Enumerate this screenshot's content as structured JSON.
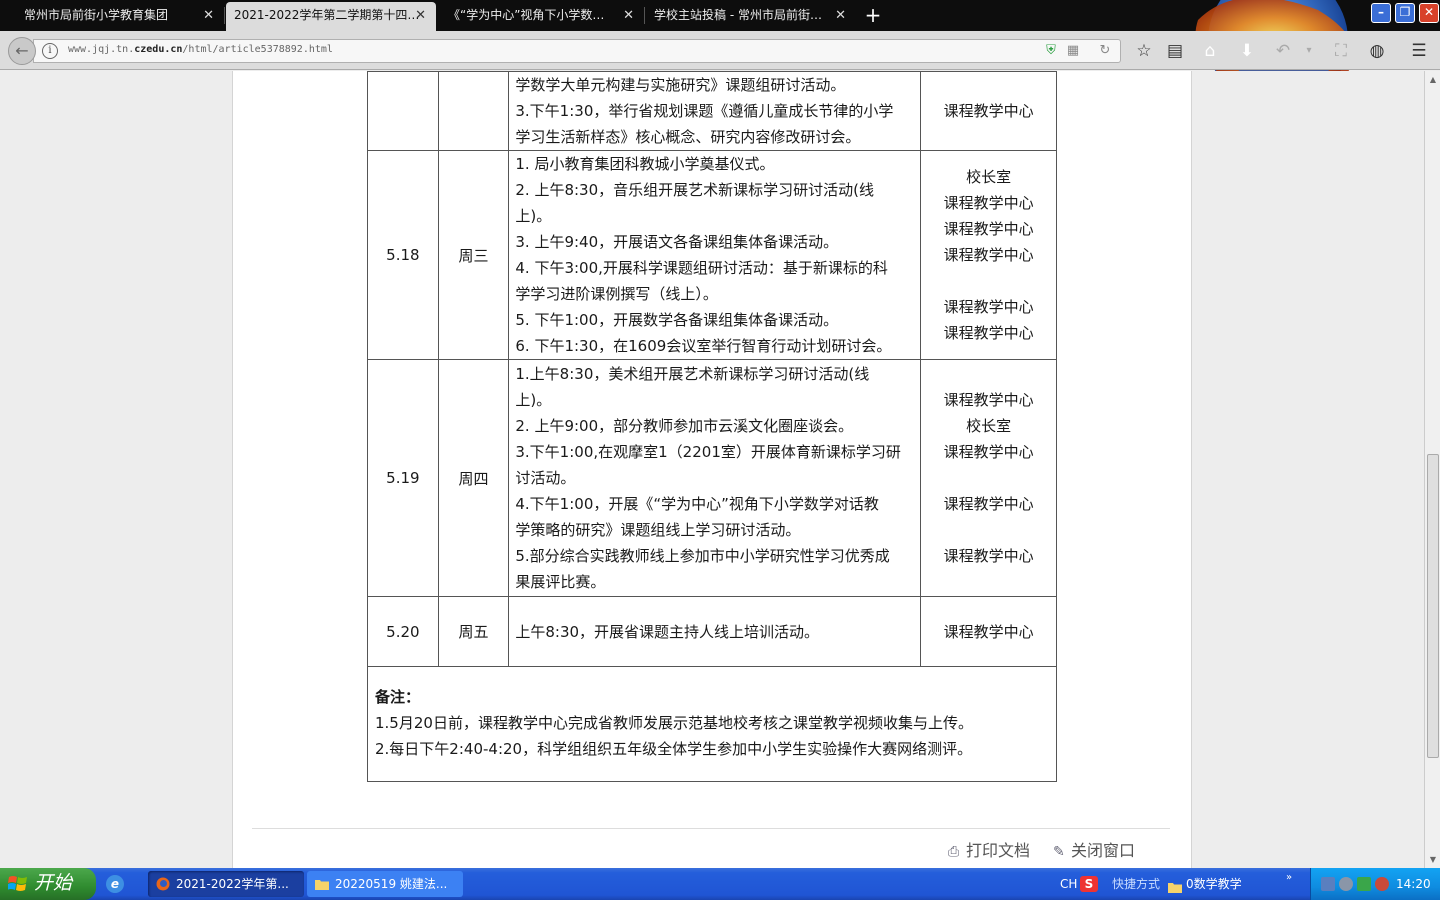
{
  "browser": {
    "tabs": [
      {
        "label": "常州市局前街小学教育集团",
        "active": false
      },
      {
        "label": "2021-2022学年第二学期第十四…",
        "active": true
      },
      {
        "label": "《“学为中心”视角下小学数…",
        "active": false
      },
      {
        "label": "学校主站投稿 - 常州市局前街…",
        "active": false
      }
    ],
    "url_prefix": "www.jqj.tn.",
    "url_domain": "czedu.cn",
    "url_path": "/html/article5378892.html"
  },
  "schedule": {
    "top_partial": {
      "activities": [
        "学数学大单元构建与实施研究》课题组研讨活动。",
        "3.下午1:30，举行省规划课题《遵循儿童成长节律的小学",
        "学习生活新样态》核心概念、研究内容修改研讨会。"
      ],
      "dept": "课程教学中心"
    },
    "rows": [
      {
        "date": "5.18",
        "day": "周三",
        "activities": [
          "1. 局小教育集团科教城小学奠基仪式。",
          "2. 上午8:30，音乐组开展艺术新课标学习研讨活动(线",
          "上)。",
          "3. 上午9:40，开展语文各备课组集体备课活动。",
          "4. 下午3:00,开展科学课题组研讨活动：基于新课标的科",
          "学学习进阶课例撰写（线上）。",
          "5. 下午1:00，开展数学各备课组集体备课活动。",
          "6. 下午1:30，在1609会议室举行智育行动计划研讨会。"
        ],
        "depts": [
          "校长室",
          "课程教学中心",
          "课程教学中心",
          "课程教学中心",
          "",
          "课程教学中心",
          "课程教学中心"
        ]
      },
      {
        "date": "5.19",
        "day": "周四",
        "activities": [
          "1.上午8:30，美术组开展艺术新课标学习研讨活动(线",
          "上)。",
          "2. 上午9:00，部分教师参加市云溪文化圈座谈会。",
          "3.下午1:00,在观摩室1（2201室）开展体育新课标学习研",
          "讨活动。",
          "4.下午1:00，开展《“学为中心”视角下小学数学对话教",
          "学策略的研究》课题组线上学习研讨活动。",
          "5.部分综合实践教师线上参加市中小学研究性学习优秀成",
          "果展评比赛。"
        ],
        "depts": [
          "课程教学中心",
          "校长室",
          "课程教学中心",
          "",
          "课程教学中心",
          "",
          "课程教学中心"
        ]
      },
      {
        "date": "5.20",
        "day": "周五",
        "activities": [
          "上午8:30，开展省课题主持人线上培训活动。"
        ],
        "depts": [
          "课程教学中心"
        ]
      }
    ]
  },
  "notes": {
    "title": "备注：",
    "items": [
      "1.5月20日前，课程教学中心完成省教师发展示范基地校考核之课堂教学视频收集与上传。",
      "2.每日下午2:40-4:20，科学组组织五年级全体学生参加中小学生实验操作大赛网络测评。"
    ]
  },
  "footer": {
    "print_label": "打印文档",
    "close_label": "关闭窗口"
  },
  "taskbar": {
    "start_label": "开始",
    "tasks": [
      "2021-2022学年第...",
      "20220519 姚建法..."
    ],
    "ime": "CH",
    "shortcut_label": "快捷方式",
    "folder_label": "0数学教学",
    "clock": "14:20"
  }
}
